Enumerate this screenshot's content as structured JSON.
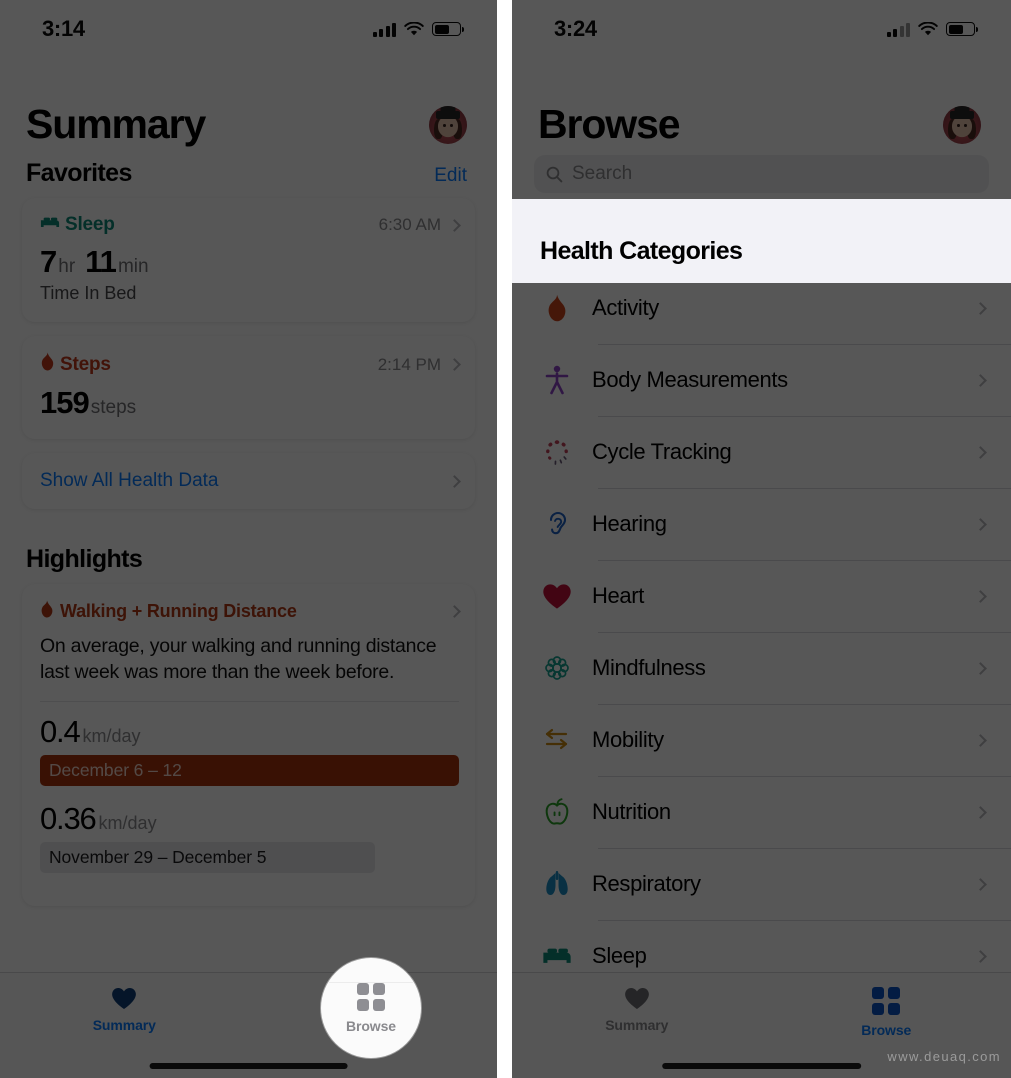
{
  "left": {
    "status": {
      "time": "3:14",
      "signal_bars": 4,
      "wifi": "wifi-icon",
      "battery": "battery-icon"
    },
    "title": "Summary",
    "avatar": "memoji-avatar",
    "favorites": {
      "heading": "Favorites",
      "action": "Edit"
    },
    "cards": [
      {
        "name": "Sleep",
        "color": "#0e8a78",
        "icon": "bed-icon",
        "time": "6:30 AM",
        "value_parts": [
          {
            "num": "7",
            "unit": "hr"
          },
          {
            "num": "11",
            "unit": "min"
          }
        ],
        "subtitle": "Time In Bed"
      },
      {
        "name": "Steps",
        "color": "#c0391b",
        "icon": "flame-icon",
        "time": "2:14 PM",
        "value_parts": [
          {
            "num": "159",
            "unit": "steps"
          }
        ],
        "subtitle": ""
      }
    ],
    "show_all": "Show All Health Data",
    "highlights": {
      "heading": "Highlights",
      "card": {
        "title": "Walking + Running Distance",
        "icon": "flame-icon",
        "color": "#b33a15",
        "body": "On average, your walking and running distance last week was more than the week before.",
        "rows": [
          {
            "value": "0.4",
            "unit": "km/day",
            "range": "December 6 – 12",
            "style": "primary"
          },
          {
            "value": "0.36",
            "unit": "km/day",
            "range": "November 29 – December 5",
            "style": "secondary"
          }
        ]
      }
    },
    "tabs": [
      {
        "label": "Summary",
        "icon": "heart-icon",
        "state": "active"
      },
      {
        "label": "Browse",
        "icon": "grid-icon",
        "state": "inactive"
      }
    ],
    "spotlight_tab": "Browse"
  },
  "right": {
    "status": {
      "time": "3:24",
      "signal_bars": 2,
      "wifi": "wifi-icon",
      "battery": "battery-icon"
    },
    "title": "Browse",
    "avatar": "memoji-avatar",
    "search": {
      "placeholder": "Search",
      "icon": "search-icon"
    },
    "categories_heading": "Health Categories",
    "categories": [
      {
        "label": "Activity",
        "icon": "flame-icon",
        "color": "#c9451c"
      },
      {
        "label": "Body Measurements",
        "icon": "person-icon",
        "color": "#8e44c8"
      },
      {
        "label": "Cycle Tracking",
        "icon": "cycle-icon",
        "color": "#c24058"
      },
      {
        "label": "Hearing",
        "icon": "ear-icon",
        "color": "#1f62c4"
      },
      {
        "label": "Heart",
        "icon": "heart-icon",
        "color": "#c2103a"
      },
      {
        "label": "Mindfulness",
        "icon": "flower-icon",
        "color": "#16a090"
      },
      {
        "label": "Mobility",
        "icon": "arrows-icon",
        "color": "#c98a12"
      },
      {
        "label": "Nutrition",
        "icon": "apple-icon",
        "color": "#2aa128"
      },
      {
        "label": "Respiratory",
        "icon": "lungs-icon",
        "color": "#1b8ec4"
      },
      {
        "label": "Sleep",
        "icon": "bed-icon",
        "color": "#0e8a78"
      }
    ],
    "tabs": [
      {
        "label": "Summary",
        "icon": "heart-icon",
        "state": "inactive"
      },
      {
        "label": "Browse",
        "icon": "grid-icon",
        "state": "active"
      }
    ]
  },
  "watermark": "www.deuaq.com"
}
